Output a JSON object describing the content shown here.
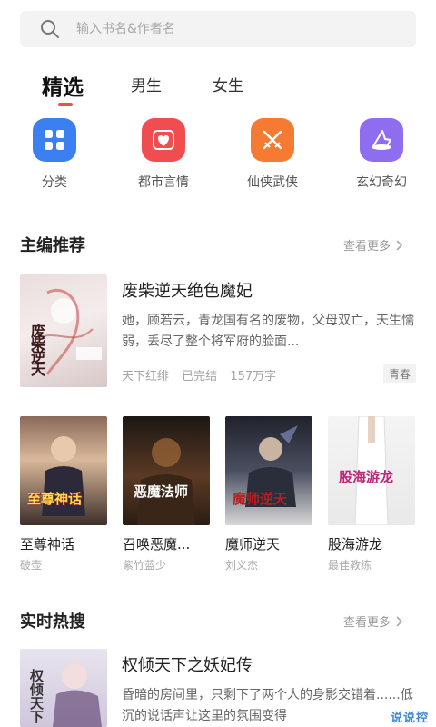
{
  "search": {
    "placeholder": "输入书名&作者名"
  },
  "tabs": [
    {
      "label": "精选",
      "active": true
    },
    {
      "label": "男生",
      "active": false
    },
    {
      "label": "女生",
      "active": false
    }
  ],
  "categories": [
    {
      "label": "分类",
      "icon": "grid-icon",
      "color": "#3b7ff0"
    },
    {
      "label": "都市言情",
      "icon": "heart-icon",
      "color": "#ef4d50"
    },
    {
      "label": "仙侠武侠",
      "icon": "swords-icon",
      "color": "#f57b32"
    },
    {
      "label": "玄幻奇幻",
      "icon": "wizard-hat-icon",
      "color": "#8e6df0"
    }
  ],
  "editor_section": {
    "title": "主编推荐",
    "more": "查看更多",
    "feature": {
      "title": "废柴逆天绝色魔妃",
      "description": "她，顾若云，青龙国有名的废物，父母双亡，天生懦弱，丢尽了整个将军府的脸面...",
      "author": "天下红绯",
      "status": "已完结",
      "words": "157万字",
      "tag": "青春",
      "cover_text": "废柴逆天"
    },
    "grid": [
      {
        "title": "至尊神话",
        "author": "破壶",
        "cover_text": "至尊神话"
      },
      {
        "title": "召唤恶魔...",
        "author": "紫竹蓝少",
        "cover_text": "恶魔法师"
      },
      {
        "title": "魔师逆天",
        "author": "刘义杰",
        "cover_text": "魔师逆天"
      },
      {
        "title": "股海游龙",
        "author": "最佳教练",
        "cover_text": "股海游龙"
      }
    ]
  },
  "hot_section": {
    "title": "实时热搜",
    "more": "查看更多",
    "feature": {
      "title": "权倾天下之妖妃传",
      "description": "昏暗的房间里，只剩下了两个人的身影交错着......低沉的说话声让这里的氛围变得",
      "cover_text": "权倾天下"
    }
  },
  "watermark": "说说控"
}
